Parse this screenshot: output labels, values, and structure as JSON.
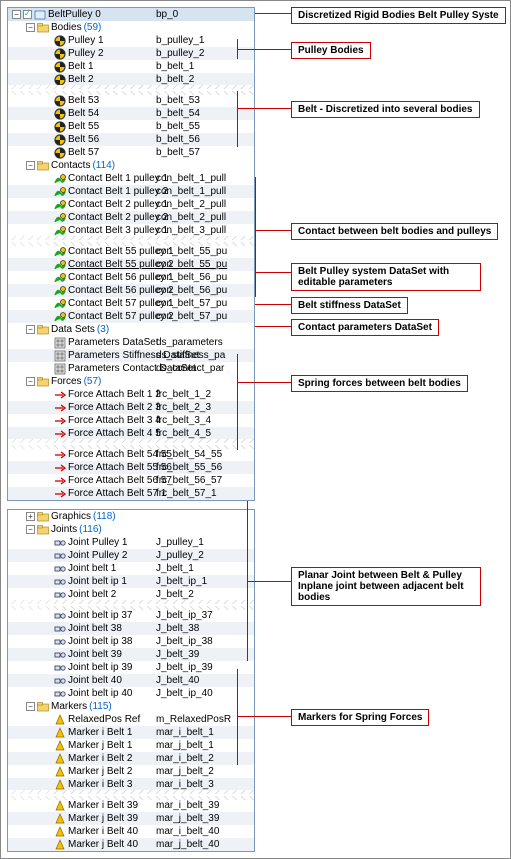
{
  "root": {
    "label": "BeltPulley 0",
    "val": "bp_0"
  },
  "bodies": {
    "label": "Bodies",
    "count": "(59)",
    "items": [
      {
        "l": "Pulley 1",
        "v": "b_pulley_1"
      },
      {
        "l": "Pulley 2",
        "v": "b_pulley_2"
      },
      {
        "l": "Belt 1",
        "v": "b_belt_1"
      },
      {
        "l": "Belt 2",
        "v": "b_belt_2"
      }
    ],
    "items2": [
      {
        "l": "Belt 53",
        "v": "b_belt_53"
      },
      {
        "l": "Belt 54",
        "v": "b_belt_54"
      },
      {
        "l": "Belt 55",
        "v": "b_belt_55"
      },
      {
        "l": "Belt 56",
        "v": "b_belt_56"
      },
      {
        "l": "Belt 57",
        "v": "b_belt_57"
      }
    ]
  },
  "contacts": {
    "label": "Contacts",
    "count": "(114)",
    "items": [
      {
        "l": "Contact Belt 1 pulley 1",
        "v": "con_belt_1_pull"
      },
      {
        "l": "Contact Belt 1 pulley 2",
        "v": "con_belt_1_pull"
      },
      {
        "l": "Contact Belt 2 pulley 1",
        "v": "con_belt_2_pull"
      },
      {
        "l": "Contact Belt 2 pulley 2",
        "v": "con_belt_2_pull"
      },
      {
        "l": "Contact Belt 3 pulley 1",
        "v": "con_belt_3_pull"
      }
    ],
    "items2": [
      {
        "l": "Contact Belt 55 pulley 1",
        "v": "con_belt_55_pu"
      },
      {
        "l": "Contact Belt 55 pulley 2",
        "v": "con_belt_55_pu",
        "u": true
      },
      {
        "l": "Contact Belt 56 pulley 1",
        "v": "con_belt_56_pu"
      },
      {
        "l": "Contact Belt 56 pulley 2",
        "v": "con_belt_56_pu"
      },
      {
        "l": "Contact Belt 57 pulley 1",
        "v": "con_belt_57_pu"
      },
      {
        "l": "Contact Belt 57 pulley 2",
        "v": "con_belt_57_pu"
      }
    ]
  },
  "datasets": {
    "label": "Data Sets",
    "count": "(3)",
    "items": [
      {
        "l": "Parameters DataSet",
        "v": "ds_parameters"
      },
      {
        "l": "Parameters Stiffness DataSet",
        "v": "ds_stiffness_pa"
      },
      {
        "l": "Parameters Contact DataSet",
        "v": "ds_contact_par"
      }
    ]
  },
  "forces": {
    "label": "Forces",
    "count": "(57)",
    "items": [
      {
        "l": "Force Attach Belt 1 2",
        "v": "frc_belt_1_2"
      },
      {
        "l": "Force Attach Belt 2 3",
        "v": "frc_belt_2_3"
      },
      {
        "l": "Force Attach Belt 3 4",
        "v": "frc_belt_3_4"
      },
      {
        "l": "Force Attach Belt 4 5",
        "v": "frc_belt_4_5"
      }
    ],
    "items2": [
      {
        "l": "Force Attach Belt 54 55",
        "v": "frc_belt_54_55"
      },
      {
        "l": "Force Attach Belt 55 56",
        "v": "frc_belt_55_56"
      },
      {
        "l": "Force Attach Belt 56 57",
        "v": "frc_belt_56_57"
      },
      {
        "l": "Force Attach Belt 57 1",
        "v": "frc_belt_57_1"
      }
    ]
  },
  "graphics": {
    "label": "Graphics",
    "count": "(118)"
  },
  "joints": {
    "label": "Joints",
    "count": "(116)",
    "items": [
      {
        "l": "Joint Pulley 1",
        "v": "J_pulley_1"
      },
      {
        "l": "Joint Pulley 2",
        "v": "J_pulley_2"
      },
      {
        "l": "Joint belt 1",
        "v": "J_belt_1"
      },
      {
        "l": "Joint belt ip 1",
        "v": "J_belt_ip_1"
      },
      {
        "l": "Joint belt 2",
        "v": "J_belt_2"
      }
    ],
    "items2": [
      {
        "l": "Joint belt ip 37",
        "v": "J_belt_ip_37"
      },
      {
        "l": "Joint belt 38",
        "v": "J_belt_38"
      },
      {
        "l": "Joint belt ip 38",
        "v": "J_belt_ip_38"
      },
      {
        "l": "Joint belt 39",
        "v": "J_belt_39"
      },
      {
        "l": "Joint belt ip 39",
        "v": "J_belt_ip_39"
      },
      {
        "l": "Joint belt 40",
        "v": "J_belt_40"
      },
      {
        "l": "Joint belt ip 40",
        "v": "J_belt_ip_40"
      }
    ]
  },
  "markers": {
    "label": "Markers",
    "count": "(115)",
    "items": [
      {
        "l": "RelaxedPos Ref",
        "v": "m_RelaxedPosR"
      },
      {
        "l": "Marker i Belt 1",
        "v": "mar_i_belt_1"
      },
      {
        "l": "Marker j Belt 1",
        "v": "mar_j_belt_1"
      },
      {
        "l": "Marker i Belt 2",
        "v": "mar_i_belt_2"
      },
      {
        "l": "Marker j Belt 2",
        "v": "mar_j_belt_2"
      },
      {
        "l": "Marker i Belt 3",
        "v": "mar_i_belt_3"
      }
    ],
    "items2": [
      {
        "l": "Marker i Belt 39",
        "v": "mar_i_belt_39"
      },
      {
        "l": "Marker j Belt 39",
        "v": "mar_j_belt_39"
      },
      {
        "l": "Marker i Belt 40",
        "v": "mar_i_belt_40"
      },
      {
        "l": "Marker j Belt 40",
        "v": "mar_j_belt_40"
      }
    ]
  },
  "annotations": {
    "a1": "Discretized Rigid Bodies Belt Pulley Syste",
    "a2": "Pulley Bodies",
    "a3": "Belt - Discretized into several bodies",
    "a4": "Contact between belt bodies and pulleys",
    "a5": "Belt Pulley system DataSet with editable parameters",
    "a6": "Belt stiffness DataSet",
    "a7": "Contact parameters DataSet",
    "a8": "Spring forces between belt bodies",
    "a9": "Planar Joint between Belt & Pulley Inplane joint between adjacent belt bodies",
    "a10": "Markers for Spring Forces"
  }
}
